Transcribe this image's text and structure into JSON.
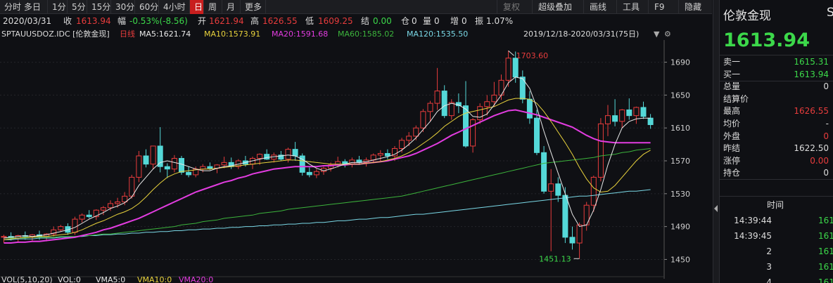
{
  "toolbar": {
    "left_tabs": [
      "分时",
      "多日",
      "1分",
      "5分",
      "15分",
      "30分",
      "60分",
      "4小时",
      "日",
      "周",
      "月",
      "更多"
    ],
    "active_tab": "日",
    "right_tabs": [
      "复权",
      "超级叠加",
      "画线",
      "工具",
      "F9",
      "隐藏"
    ]
  },
  "quote_bar": {
    "date": "2020/03/31",
    "close_label": "收",
    "close": "1613.94",
    "change_label": "幅",
    "change": "-0.53%(-8.56)",
    "open_label": "开",
    "open": "1621.94",
    "high_label": "高",
    "high": "1626.55",
    "low_label": "低",
    "low": "1609.25",
    "settle_label": "结",
    "settle": "0.00",
    "oi_label": "仓",
    "oi": "0",
    "vol_label": "量",
    "vol": "0",
    "inc_label": "增",
    "inc": "0",
    "amp_label": "振",
    "amp": "1.07%"
  },
  "ma_bar": {
    "symbol": "SPTAUUSDOZ.IDC [伦敦金现]",
    "period": "日线",
    "ma5": "MA5:1621.74",
    "ma10": "MA10:1573.91",
    "ma20": "MA20:1591.68",
    "ma60": "MA60:1585.02",
    "ma120": "MA120:1535.50",
    "range": "2019/12/18-2020/03/31(75日)"
  },
  "volume_bar": {
    "vol": "VOL(5,10,20)",
    "vol_val": "VOL:0",
    "vma5": "VMA5:0",
    "vma10": "VMA10:0",
    "vma20": "VMA20:0"
  },
  "colors": {
    "up": "#e83c3c",
    "down": "#54d8d8",
    "ma5": "#e8e8e8",
    "ma10": "#e8d23c",
    "ma20": "#e23ce0",
    "ma60": "#3cb43c",
    "ma120": "#7ad8e6",
    "panel_green": "#3cd84a",
    "panel_red": "#e83c3c"
  },
  "chart_data": {
    "type": "candlestick",
    "ylim": [
      1435,
      1717
    ],
    "y_ticks": [
      1450,
      1490,
      1530,
      1570,
      1610,
      1650,
      1690
    ],
    "annotations": {
      "max": "1703.60",
      "min": "1451.13"
    },
    "candles": [
      [
        1477,
        1480,
        1470,
        1478
      ],
      [
        1478,
        1483,
        1473,
        1476
      ],
      [
        1476,
        1480,
        1471,
        1479
      ],
      [
        1479,
        1484,
        1474,
        1478
      ],
      [
        1478,
        1481,
        1472,
        1480
      ],
      [
        1480,
        1485,
        1474,
        1478
      ],
      [
        1478,
        1482,
        1472,
        1481
      ],
      [
        1481,
        1490,
        1478,
        1486
      ],
      [
        1486,
        1492,
        1484,
        1490
      ],
      [
        1490,
        1494,
        1480,
        1483
      ],
      [
        1483,
        1502,
        1480,
        1499
      ],
      [
        1499,
        1506,
        1495,
        1504
      ],
      [
        1504,
        1510,
        1500,
        1502
      ],
      [
        1502,
        1511,
        1498,
        1510
      ],
      [
        1510,
        1515,
        1504,
        1513
      ],
      [
        1513,
        1522,
        1509,
        1518
      ],
      [
        1518,
        1525,
        1513,
        1520
      ],
      [
        1520,
        1532,
        1516,
        1527
      ],
      [
        1527,
        1553,
        1524,
        1550
      ],
      [
        1550,
        1582,
        1544,
        1576
      ],
      [
        1576,
        1584,
        1562,
        1566
      ],
      [
        1566,
        1588,
        1560,
        1588
      ],
      [
        1588,
        1611,
        1556,
        1563
      ],
      [
        1563,
        1567,
        1549,
        1560
      ],
      [
        1560,
        1577,
        1556,
        1573
      ],
      [
        1573,
        1576,
        1553,
        1556
      ],
      [
        1556,
        1563,
        1550,
        1553
      ],
      [
        1553,
        1563,
        1550,
        1560
      ],
      [
        1560,
        1566,
        1556,
        1563
      ],
      [
        1563,
        1568,
        1559,
        1561
      ],
      [
        1561,
        1566,
        1555,
        1565
      ],
      [
        1565,
        1575,
        1561,
        1568
      ],
      [
        1568,
        1574,
        1560,
        1563
      ],
      [
        1563,
        1572,
        1560,
        1570
      ],
      [
        1570,
        1576,
        1563,
        1566
      ],
      [
        1566,
        1575,
        1560,
        1573
      ],
      [
        1573,
        1579,
        1565,
        1578
      ],
      [
        1578,
        1584,
        1571,
        1572
      ],
      [
        1572,
        1580,
        1568,
        1577
      ],
      [
        1577,
        1582,
        1570,
        1572
      ],
      [
        1572,
        1586,
        1568,
        1584
      ],
      [
        1584,
        1593,
        1570,
        1576
      ],
      [
        1576,
        1579,
        1552,
        1556
      ],
      [
        1556,
        1562,
        1550,
        1553
      ],
      [
        1553,
        1560,
        1549,
        1557
      ],
      [
        1557,
        1563,
        1553,
        1561
      ],
      [
        1561,
        1568,
        1557,
        1565
      ],
      [
        1565,
        1575,
        1562,
        1569
      ],
      [
        1569,
        1572,
        1562,
        1566
      ],
      [
        1566,
        1574,
        1562,
        1571
      ],
      [
        1571,
        1576,
        1565,
        1568
      ],
      [
        1568,
        1574,
        1563,
        1571
      ],
      [
        1571,
        1579,
        1567,
        1577
      ],
      [
        1577,
        1583,
        1570,
        1579
      ],
      [
        1579,
        1584,
        1572,
        1576
      ],
      [
        1576,
        1588,
        1570,
        1585
      ],
      [
        1585,
        1598,
        1580,
        1595
      ],
      [
        1595,
        1605,
        1588,
        1600
      ],
      [
        1600,
        1613,
        1595,
        1610
      ],
      [
        1610,
        1633,
        1605,
        1630
      ],
      [
        1630,
        1643,
        1618,
        1640
      ],
      [
        1640,
        1683,
        1632,
        1655
      ],
      [
        1655,
        1662,
        1622,
        1625
      ],
      [
        1625,
        1645,
        1620,
        1641
      ],
      [
        1641,
        1652,
        1628,
        1637
      ],
      [
        1637,
        1667,
        1586,
        1588
      ],
      [
        1588,
        1622,
        1580,
        1620
      ],
      [
        1620,
        1640,
        1615,
        1636
      ],
      [
        1636,
        1650,
        1625,
        1642
      ],
      [
        1642,
        1666,
        1636,
        1650
      ],
      [
        1650,
        1675,
        1644,
        1668
      ],
      [
        1668,
        1704,
        1660,
        1695
      ],
      [
        1695,
        1703,
        1665,
        1672
      ],
      [
        1672,
        1680,
        1640,
        1645
      ],
      [
        1645,
        1655,
        1615,
        1622
      ],
      [
        1622,
        1632,
        1577,
        1580
      ],
      [
        1580,
        1588,
        1530,
        1533
      ],
      [
        1533,
        1560,
        1460,
        1542
      ],
      [
        1542,
        1550,
        1520,
        1528
      ],
      [
        1528,
        1538,
        1470,
        1477
      ],
      [
        1477,
        1490,
        1462,
        1470
      ],
      [
        1470,
        1495,
        1451,
        1492
      ],
      [
        1492,
        1520,
        1485,
        1516
      ],
      [
        1516,
        1552,
        1508,
        1550
      ],
      [
        1550,
        1622,
        1545,
        1615
      ],
      [
        1615,
        1638,
        1600,
        1625
      ],
      [
        1625,
        1645,
        1612,
        1618
      ],
      [
        1618,
        1633,
        1610,
        1632
      ],
      [
        1632,
        1646,
        1620,
        1625
      ],
      [
        1625,
        1636,
        1615,
        1635
      ],
      [
        1635,
        1642,
        1621,
        1624
      ],
      [
        1622,
        1627,
        1609,
        1614
      ]
    ],
    "ma5": [
      1476,
      1477,
      1478,
      1479,
      1478,
      1479,
      1480,
      1482,
      1484,
      1486,
      1489,
      1494,
      1499,
      1503,
      1507,
      1512,
      1515,
      1519,
      1526,
      1540,
      1550,
      1560,
      1568,
      1570,
      1568,
      1566,
      1563,
      1560,
      1558,
      1558,
      1561,
      1563,
      1564,
      1566,
      1568,
      1570,
      1572,
      1574,
      1575,
      1576,
      1577,
      1576,
      1572,
      1566,
      1561,
      1558,
      1560,
      1563,
      1566,
      1568,
      1568,
      1569,
      1571,
      1573,
      1575,
      1578,
      1583,
      1590,
      1598,
      1608,
      1618,
      1630,
      1637,
      1640,
      1638,
      1633,
      1624,
      1623,
      1627,
      1638,
      1650,
      1665,
      1672,
      1670,
      1658,
      1635,
      1606,
      1580,
      1555,
      1530,
      1505,
      1490,
      1492,
      1510,
      1535,
      1565,
      1590,
      1610,
      1618,
      1621,
      1622,
      1622
    ],
    "ma10": [
      1474,
      1475,
      1476,
      1477,
      1477,
      1478,
      1478,
      1479,
      1480,
      1481,
      1483,
      1486,
      1490,
      1494,
      1497,
      1501,
      1505,
      1508,
      1512,
      1518,
      1526,
      1535,
      1543,
      1550,
      1554,
      1557,
      1558,
      1559,
      1560,
      1560,
      1561,
      1562,
      1563,
      1564,
      1565,
      1566,
      1567,
      1568,
      1569,
      1570,
      1571,
      1571,
      1570,
      1569,
      1568,
      1567,
      1566,
      1566,
      1566,
      1566,
      1566,
      1567,
      1568,
      1569,
      1571,
      1573,
      1576,
      1580,
      1585,
      1591,
      1597,
      1604,
      1612,
      1618,
      1624,
      1628,
      1630,
      1632,
      1634,
      1636,
      1640,
      1644,
      1646,
      1646,
      1645,
      1640,
      1630,
      1618,
      1605,
      1592,
      1578,
      1562,
      1548,
      1537,
      1532,
      1533,
      1540,
      1550,
      1560,
      1570,
      1578,
      1583
    ],
    "ma20": [
      1470,
      1470,
      1471,
      1471,
      1472,
      1472,
      1473,
      1474,
      1475,
      1476,
      1477,
      1479,
      1481,
      1483,
      1486,
      1488,
      1491,
      1494,
      1497,
      1500,
      1504,
      1508,
      1512,
      1516,
      1520,
      1524,
      1528,
      1532,
      1535,
      1538,
      1541,
      1544,
      1546,
      1549,
      1551,
      1554,
      1556,
      1558,
      1560,
      1561,
      1562,
      1563,
      1563,
      1563,
      1563,
      1564,
      1564,
      1565,
      1565,
      1566,
      1566,
      1567,
      1568,
      1569,
      1570,
      1572,
      1574,
      1576,
      1579,
      1583,
      1587,
      1591,
      1596,
      1601,
      1605,
      1609,
      1613,
      1617,
      1621,
      1625,
      1628,
      1631,
      1632,
      1630,
      1628,
      1626,
      1623,
      1620,
      1617,
      1614,
      1611,
      1606,
      1601,
      1597,
      1594,
      1593,
      1592,
      1592,
      1592,
      1592,
      1592,
      1592
    ],
    "ma60": [
      1476,
      1476,
      1476,
      1476,
      1477,
      1477,
      1477,
      1477,
      1478,
      1478,
      1478,
      1479,
      1479,
      1480,
      1481,
      1481,
      1482,
      1483,
      1484,
      1485,
      1486,
      1487,
      1488,
      1489,
      1490,
      1492,
      1493,
      1494,
      1496,
      1497,
      1498,
      1500,
      1501,
      1502,
      1503,
      1504,
      1506,
      1507,
      1508,
      1509,
      1511,
      1512,
      1513,
      1514,
      1515,
      1516,
      1517,
      1518,
      1519,
      1520,
      1521,
      1522,
      1523,
      1524,
      1525,
      1526,
      1527,
      1529,
      1531,
      1533,
      1535,
      1537,
      1539,
      1541,
      1543,
      1545,
      1547,
      1549,
      1551,
      1553,
      1555,
      1557,
      1559,
      1561,
      1563,
      1565,
      1567,
      1568,
      1569,
      1570,
      1571,
      1572,
      1573,
      1574,
      1576,
      1577,
      1578,
      1580,
      1581,
      1583,
      1584,
      1585
    ],
    "ma120": [
      1474,
      1474,
      1475,
      1475,
      1475,
      1476,
      1476,
      1476,
      1477,
      1477,
      1478,
      1478,
      1479,
      1479,
      1480,
      1480,
      1481,
      1481,
      1482,
      1482,
      1483,
      1483,
      1484,
      1484,
      1485,
      1485,
      1486,
      1486,
      1487,
      1487,
      1488,
      1488,
      1489,
      1489,
      1490,
      1490,
      1491,
      1491,
      1492,
      1492,
      1493,
      1493,
      1494,
      1494,
      1495,
      1495,
      1496,
      1497,
      1497,
      1498,
      1499,
      1499,
      1500,
      1501,
      1501,
      1502,
      1503,
      1504,
      1505,
      1505,
      1506,
      1507,
      1508,
      1509,
      1510,
      1511,
      1512,
      1513,
      1514,
      1515,
      1516,
      1517,
      1518,
      1519,
      1520,
      1521,
      1522,
      1523,
      1524,
      1525,
      1526,
      1527,
      1527,
      1528,
      1529,
      1530,
      1531,
      1532,
      1533,
      1533,
      1534,
      1535
    ]
  },
  "panel": {
    "title": "伦敦金现",
    "cut": "S",
    "price": "1613.94",
    "rows": [
      {
        "label": "卖一",
        "value": "1615.31",
        "color": "green"
      },
      {
        "label": "买一",
        "value": "1613.94",
        "color": "green"
      },
      {
        "label": "总量",
        "value": "0",
        "color": "white"
      },
      {
        "label": "结算价",
        "value": "",
        "color": "white"
      },
      {
        "label": "最高",
        "value": "1626.55",
        "color": "red"
      },
      {
        "label": "均价",
        "value": "-",
        "color": "white"
      },
      {
        "label": "外盘",
        "value": "0",
        "color": "red"
      },
      {
        "label": "昨结",
        "value": "1622.50",
        "color": "white"
      },
      {
        "label": "涨停",
        "value": "0.00",
        "color": "red"
      },
      {
        "label": "持仓",
        "value": "0",
        "color": "white"
      }
    ],
    "time_header": "时间",
    "ticks": [
      {
        "time": "14:39:44",
        "value": "161"
      },
      {
        "time": "14:39:45",
        "value": "161"
      },
      {
        "time": "2",
        "value": "161"
      },
      {
        "time": "3",
        "value": "161"
      },
      {
        "time": "4",
        "value": "161"
      }
    ]
  }
}
